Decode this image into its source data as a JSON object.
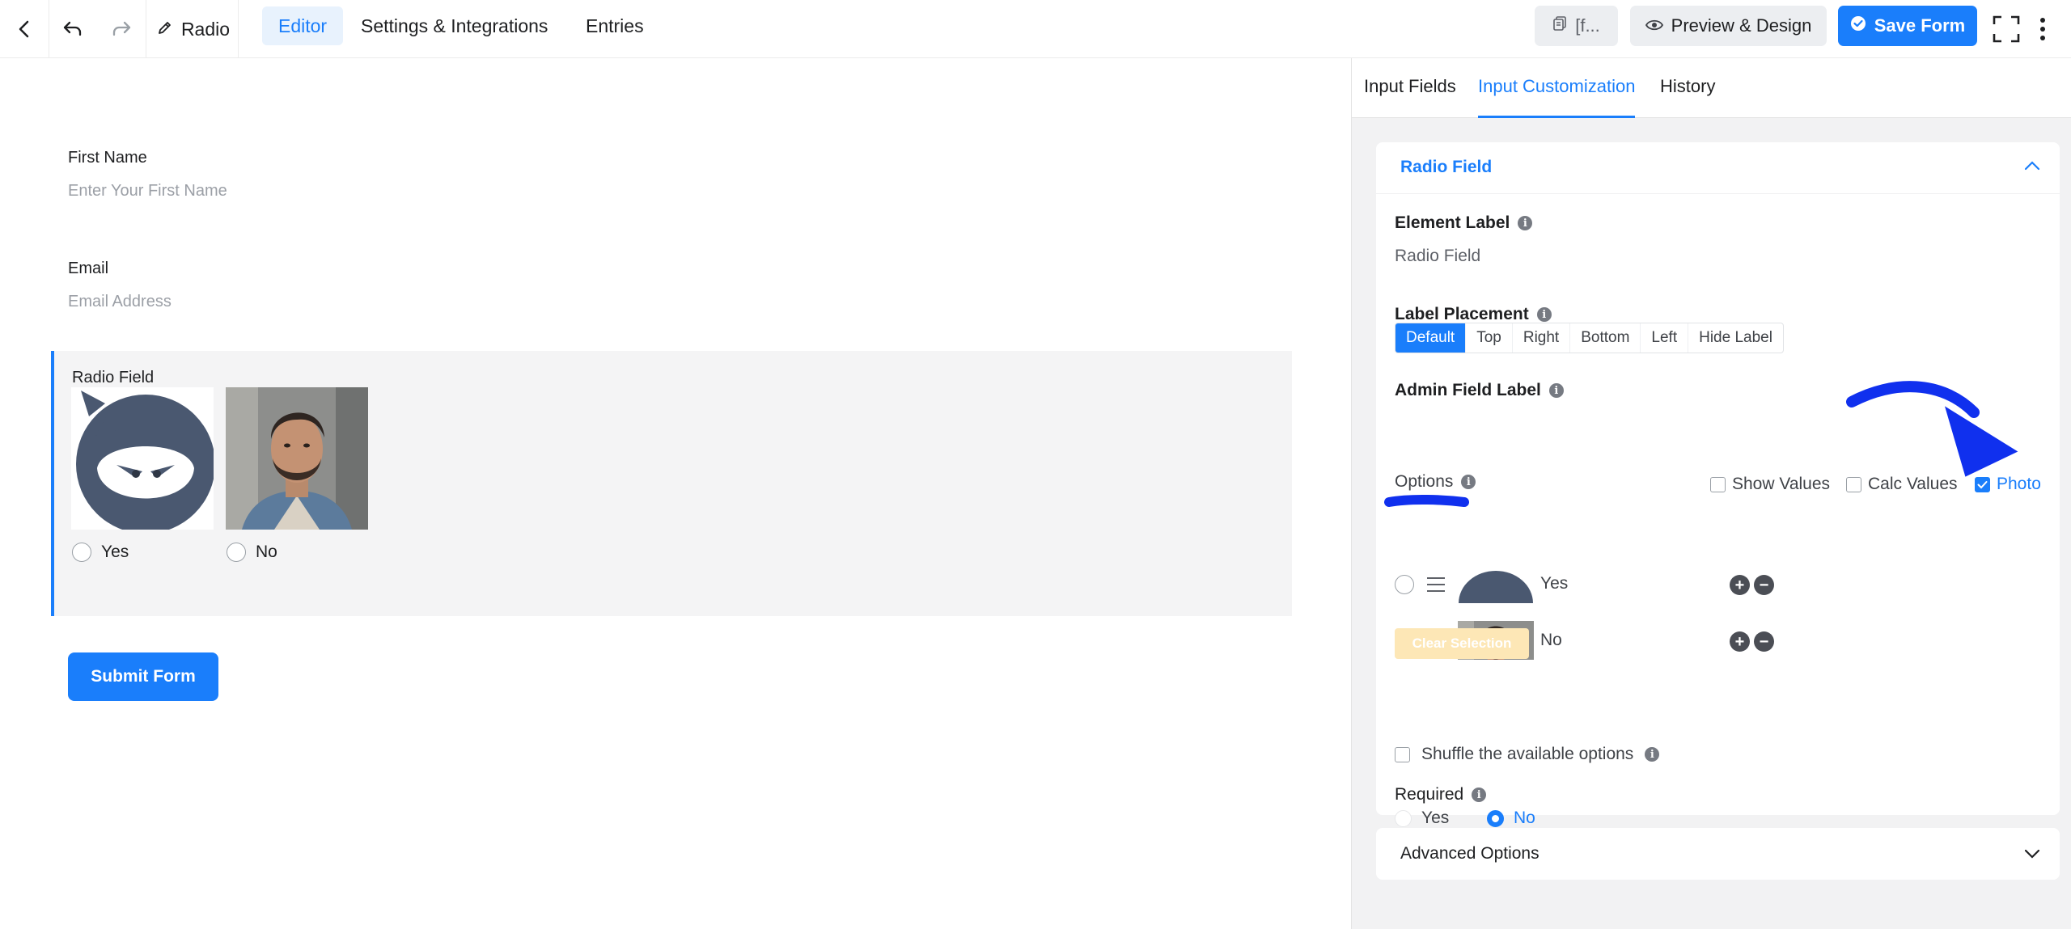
{
  "topbar": {
    "form_name": "Radio",
    "tabs": [
      "Editor",
      "Settings & Integrations",
      "Entries"
    ],
    "shortcode_label": "[f...",
    "preview_label": "Preview & Design",
    "save_label": "Save Form",
    "icons": [
      "chevron-left-icon",
      "undo-icon",
      "redo-icon",
      "pencil-icon",
      "copy-icon",
      "eye-icon",
      "check-circle-icon",
      "fullscreen-icon",
      "more-vertical-icon"
    ]
  },
  "canvas": {
    "fields": [
      {
        "label": "First Name",
        "placeholder": "Enter Your First Name"
      },
      {
        "label": "Email",
        "placeholder": "Email Address"
      }
    ],
    "radio_field": {
      "label": "Radio Field",
      "options": [
        {
          "label": "Yes",
          "image": "ninja-avatar"
        },
        {
          "label": "No",
          "image": "man-portrait"
        }
      ]
    },
    "submit_label": "Submit Form"
  },
  "panel": {
    "tabs": [
      "Input Fields",
      "Input Customization",
      "History"
    ],
    "active_tab": "Input Customization",
    "card_title": "Radio Field",
    "element_label": {
      "title": "Element Label",
      "value": "Radio Field"
    },
    "label_placement": {
      "title": "Label Placement",
      "options": [
        "Default",
        "Top",
        "Right",
        "Bottom",
        "Left",
        "Hide Label"
      ],
      "selected": "Default"
    },
    "admin_field_label": {
      "title": "Admin Field Label"
    },
    "options": {
      "title": "Options",
      "show_values": {
        "label": "Show Values",
        "checked": false
      },
      "calc_values": {
        "label": "Calc Values",
        "checked": false
      },
      "photo": {
        "label": "Photo",
        "checked": true
      },
      "items": [
        {
          "label": "Yes",
          "thumb": "ninja-avatar"
        },
        {
          "label": "No",
          "thumb": "man-portrait"
        }
      ]
    },
    "clear_selection_label": "Clear Selection",
    "shuffle_label": "Shuffle the available options",
    "required": {
      "title": "Required",
      "yes_label": "Yes",
      "no_label": "No",
      "selected": "No"
    },
    "advanced_label": "Advanced Options"
  },
  "colors": {
    "accent": "#1a7efb",
    "annotation": "#1030ee",
    "ninja": "#4a5870",
    "clear_btn": "#fde7b6"
  }
}
